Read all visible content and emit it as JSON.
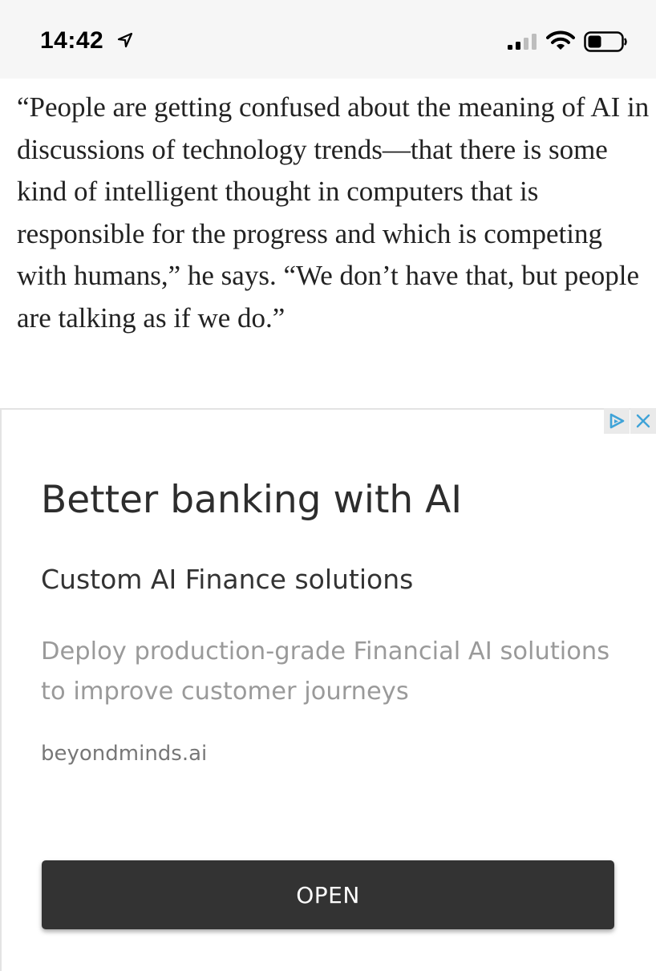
{
  "status_bar": {
    "time": "14:42",
    "icons": [
      "location-arrow-icon",
      "cellular-signal-icon",
      "wifi-icon",
      "battery-icon"
    ]
  },
  "article": {
    "paragraph": "“People are getting confused about the meaning of AI in discussions of technology trends—that there is some kind of intelligent thought in computers that is responsible for the progress and which is competing with humans,” he says. “We don’t have that, but people are talking as if we do.”"
  },
  "ad": {
    "headline": "Better banking with AI",
    "subheadline": "Custom AI Finance solutions",
    "body": "Deploy production-grade Financial AI solutions to improve customer journeys",
    "domain": "beyondminds.ai",
    "button_label": "OPEN",
    "icons": [
      "adchoices-icon",
      "close-icon"
    ],
    "colors": {
      "button_bg": "#333333",
      "adchoices_blue": "#3fa3d8",
      "body_text": "#9a9a9a"
    }
  }
}
